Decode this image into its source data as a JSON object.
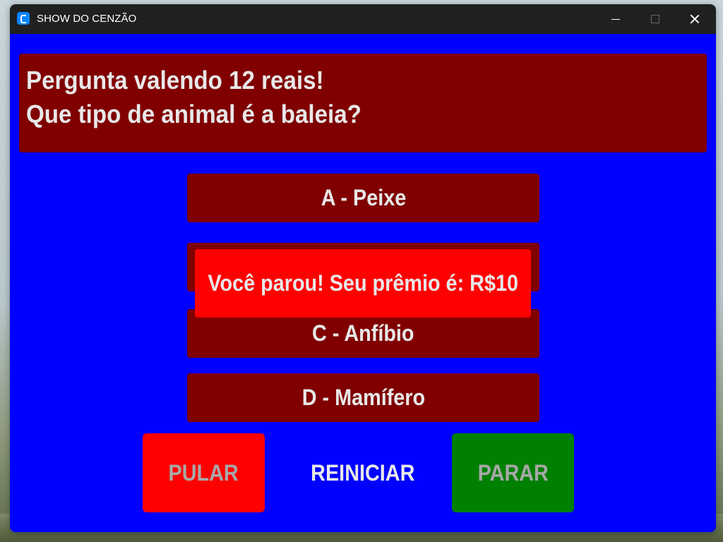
{
  "window": {
    "title": "SHOW DO CENZÃO"
  },
  "question": {
    "line1": "Pergunta valendo 12 reais!",
    "line2": "Que tipo de animal é a baleia?"
  },
  "options": {
    "a": "A - Peixe",
    "b": "",
    "c": "C - Anfíbio",
    "d": "D - Mamífero"
  },
  "popup": {
    "message": "Você parou! Seu prêmio é: R$10"
  },
  "actions": {
    "pular": "PULAR",
    "reiniciar": "REINICIAR",
    "parar": "PARAR"
  },
  "colors": {
    "background": "#0000ff",
    "panel": "#800000",
    "popup": "#ff0000",
    "pular": "#ff0000",
    "parar": "#008000"
  }
}
